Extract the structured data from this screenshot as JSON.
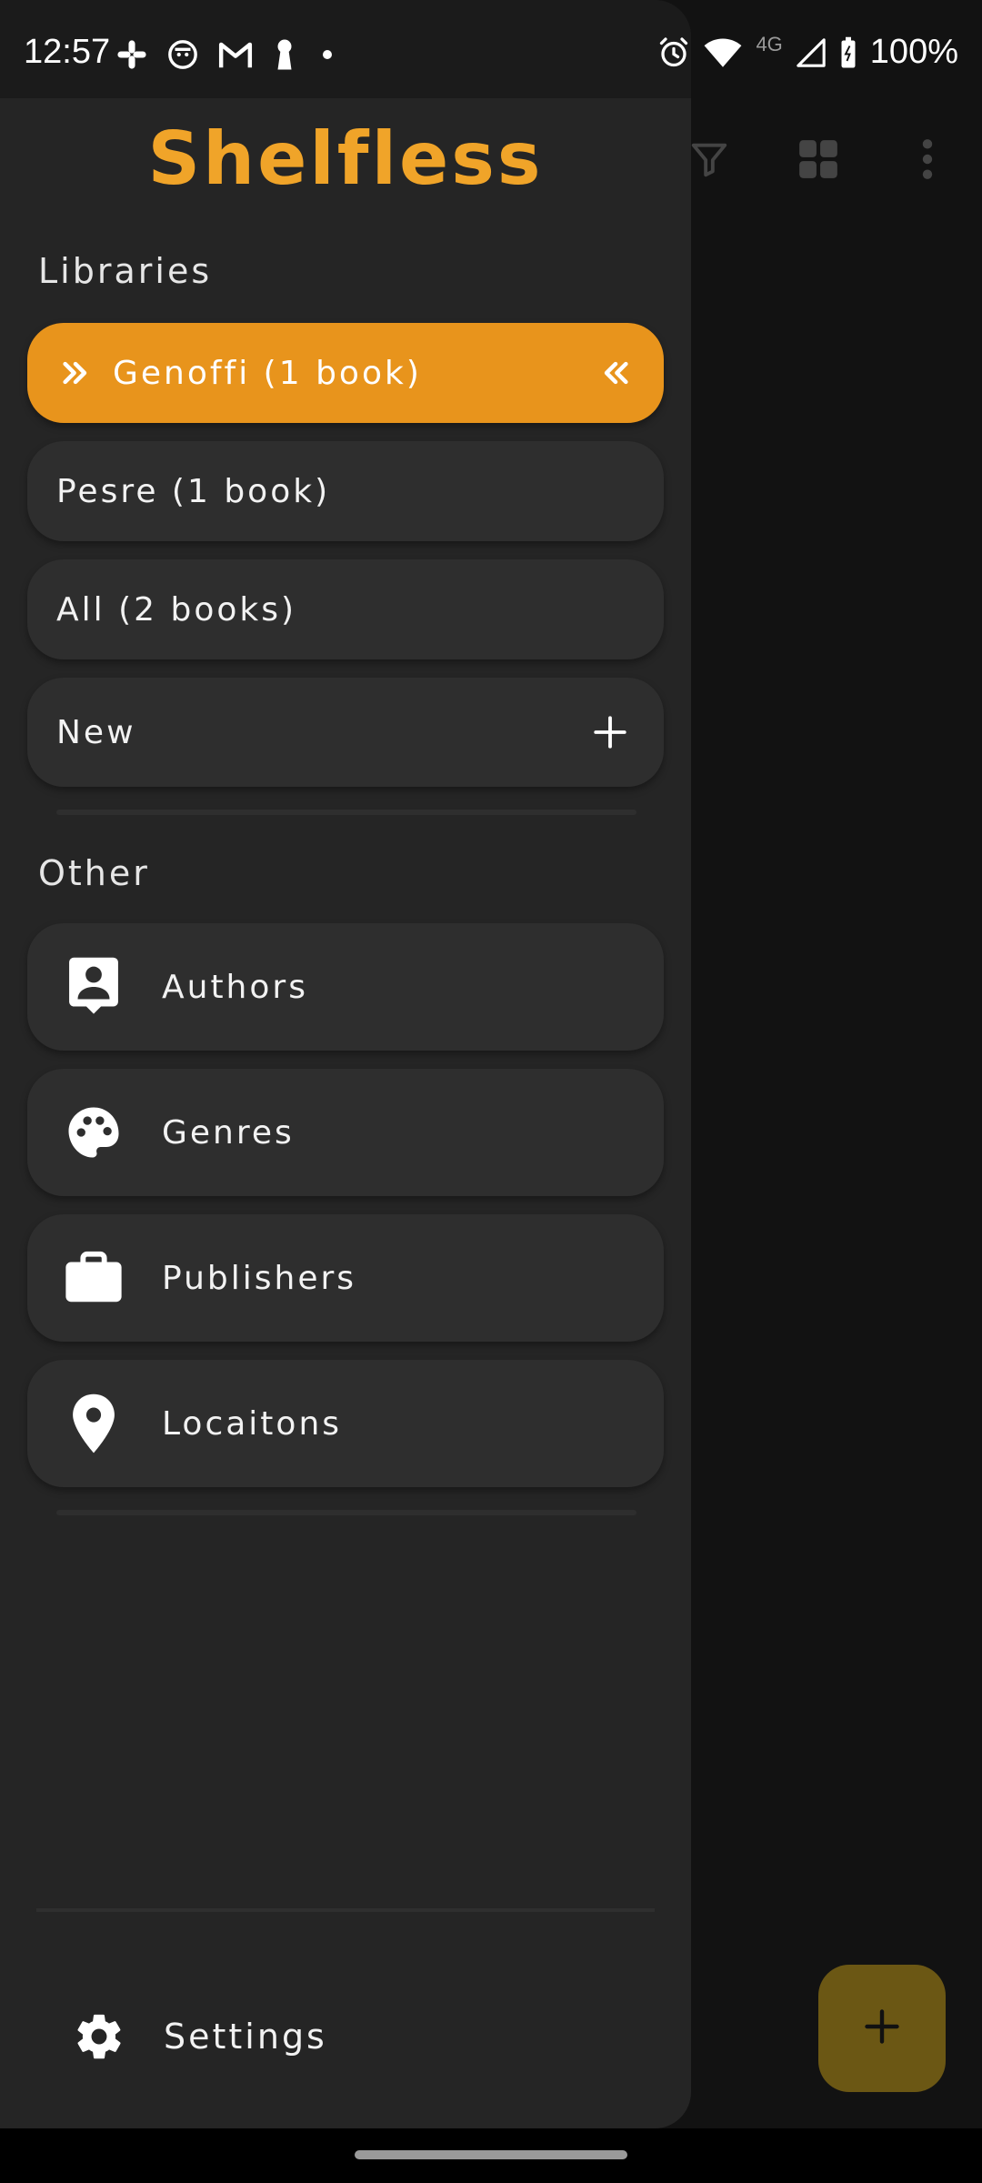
{
  "status_bar": {
    "time": "12:57",
    "network": "4G",
    "battery": "100%",
    "left_icons": [
      "slack-icon",
      "cat-face-icon",
      "gmail-icon",
      "keyhole-icon",
      "dot-icon"
    ],
    "right_icons": [
      "alarm-icon",
      "wifi-icon",
      "signal-icon",
      "battery-icon"
    ]
  },
  "drawer": {
    "app_title": "Shelfless",
    "libraries_heading": "Libraries",
    "libraries": [
      {
        "label": "Genoffi (1 book)",
        "selected": true
      },
      {
        "label": "Pesre (1 book)",
        "selected": false
      },
      {
        "label": "All (2 books)",
        "selected": false
      }
    ],
    "new_label": "New",
    "other_heading": "Other",
    "other_items": [
      {
        "label": "Authors",
        "icon": "contact-icon"
      },
      {
        "label": "Genres",
        "icon": "palette-icon"
      },
      {
        "label": "Publishers",
        "icon": "briefcase-icon"
      },
      {
        "label": "Locaitons",
        "icon": "location-pin-icon"
      }
    ],
    "settings_label": "Settings"
  },
  "background_toolbar": {
    "icons": [
      "filter-icon",
      "grid-view-icon",
      "more-vert-icon"
    ]
  },
  "fab": {
    "icon": "add-icon"
  },
  "colors": {
    "accent": "#E8941C",
    "brand_title": "#F0A429",
    "drawer_bg": "#252525",
    "item_bg": "#2E2E2E",
    "fab_bg": "#6B5714"
  }
}
